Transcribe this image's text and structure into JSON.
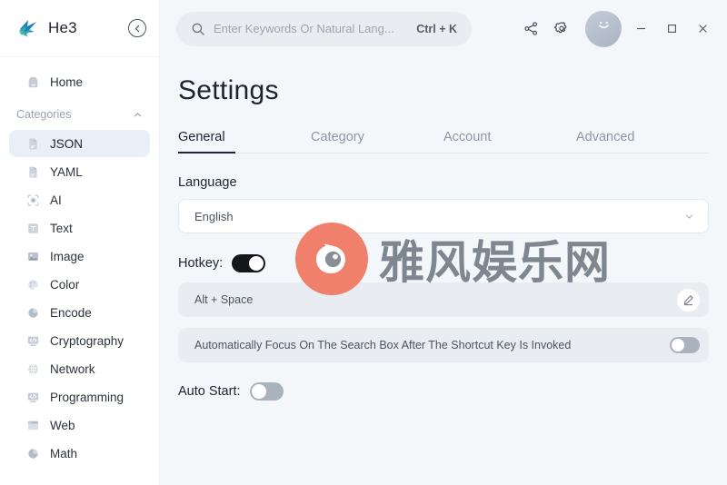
{
  "app": {
    "brand_name": "He3",
    "brand_logo_icon": "he3-arrow-logo",
    "collapse_icon": "chevron-left-circle-icon"
  },
  "sidebar": {
    "home": {
      "label": "Home",
      "icon": "home-icon"
    },
    "categories_header": {
      "label": "Categories",
      "icon": "chevron-up-icon"
    },
    "items": [
      {
        "label": "JSON",
        "icon": "file-json-icon",
        "active": true
      },
      {
        "label": "YAML",
        "icon": "file-yaml-icon",
        "active": false
      },
      {
        "label": "AI",
        "icon": "ai-target-icon",
        "active": false
      },
      {
        "label": "Text",
        "icon": "text-icon",
        "active": false
      },
      {
        "label": "Image",
        "icon": "image-icon",
        "active": false
      },
      {
        "label": "Color",
        "icon": "color-palette-icon",
        "active": false
      },
      {
        "label": "Encode",
        "icon": "encode-pie-icon",
        "active": false
      },
      {
        "label": "Cryptography",
        "icon": "crypto-screen-icon",
        "active": false
      },
      {
        "label": "Network",
        "icon": "network-globe-icon",
        "active": false
      },
      {
        "label": "Programming",
        "icon": "code-screen-icon",
        "active": false
      },
      {
        "label": "Web",
        "icon": "browser-icon",
        "active": false
      },
      {
        "label": "Math",
        "icon": "math-pie-icon",
        "active": false
      }
    ]
  },
  "titlebar": {
    "search": {
      "placeholder": "Enter Keywords Or Natural Lang...",
      "shortcut": "Ctrl + K",
      "icon": "search-icon"
    },
    "share_icon": "share-icon",
    "settings_icon": "gear-icon",
    "avatar_icon": "avatar-smiley-icon",
    "window_controls": {
      "minimize_icon": "minimize-icon",
      "maximize_icon": "maximize-icon",
      "close_icon": "close-icon"
    }
  },
  "main": {
    "page_title": "Settings",
    "tabs": [
      {
        "label": "General",
        "active": true
      },
      {
        "label": "Category",
        "active": false
      },
      {
        "label": "Account",
        "active": false
      },
      {
        "label": "Advanced",
        "active": false
      }
    ],
    "language": {
      "label": "Language",
      "value": "English",
      "chevron_icon": "chevron-down-icon"
    },
    "hotkey": {
      "label": "Hotkey:",
      "enabled": true,
      "value": "Alt + Space",
      "edit_icon": "pencil-edit-icon"
    },
    "auto_focus": {
      "label": "Automatically Focus On The Search Box After The Shortcut Key Is Invoked",
      "enabled": false
    },
    "auto_start": {
      "label": "Auto Start:",
      "enabled": false
    }
  },
  "watermark": {
    "text": "雅风娱乐网",
    "logo_icon": "bird-eye-logo-icon",
    "logo_color": "#f0806c",
    "text_color": "#7e868f"
  },
  "colors": {
    "sidebar_bg": "#ffffff",
    "main_bg": "#f4f7fa",
    "active_item_bg": "#e9eff7",
    "accent_dark": "#15161a",
    "toggle_off": "#a9b2bd",
    "panel_bg": "#e9edf2"
  }
}
